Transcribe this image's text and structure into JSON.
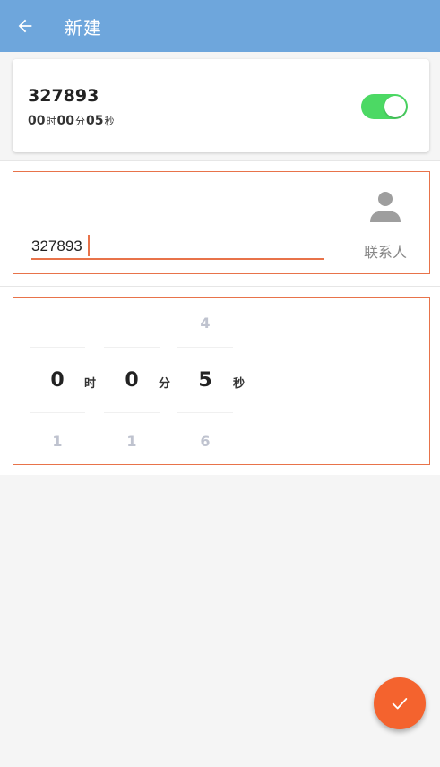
{
  "appbar": {
    "title": "新建",
    "back_icon": "arrow-left-icon"
  },
  "card": {
    "number": "327893",
    "time": {
      "hours": "00",
      "hours_unit": "时",
      "minutes": "00",
      "minutes_unit": "分",
      "seconds": "05",
      "seconds_unit": "秒"
    },
    "toggle_on": true
  },
  "input": {
    "value": "327893",
    "contacts_label": "联系人",
    "contacts_icon": "person-icon"
  },
  "picker": {
    "hours": {
      "prev": "",
      "current": "0",
      "next": "1",
      "unit": "时"
    },
    "minutes": {
      "prev": "",
      "current": "0",
      "next": "1",
      "unit": "分"
    },
    "seconds": {
      "prev": "4",
      "current": "5",
      "next": "6",
      "unit": "秒"
    }
  },
  "fab": {
    "icon": "check-icon"
  },
  "colors": {
    "appbar": "#6ea6dc",
    "accent": "#e8734a",
    "fab": "#f4632e",
    "toggle": "#4cd964"
  }
}
